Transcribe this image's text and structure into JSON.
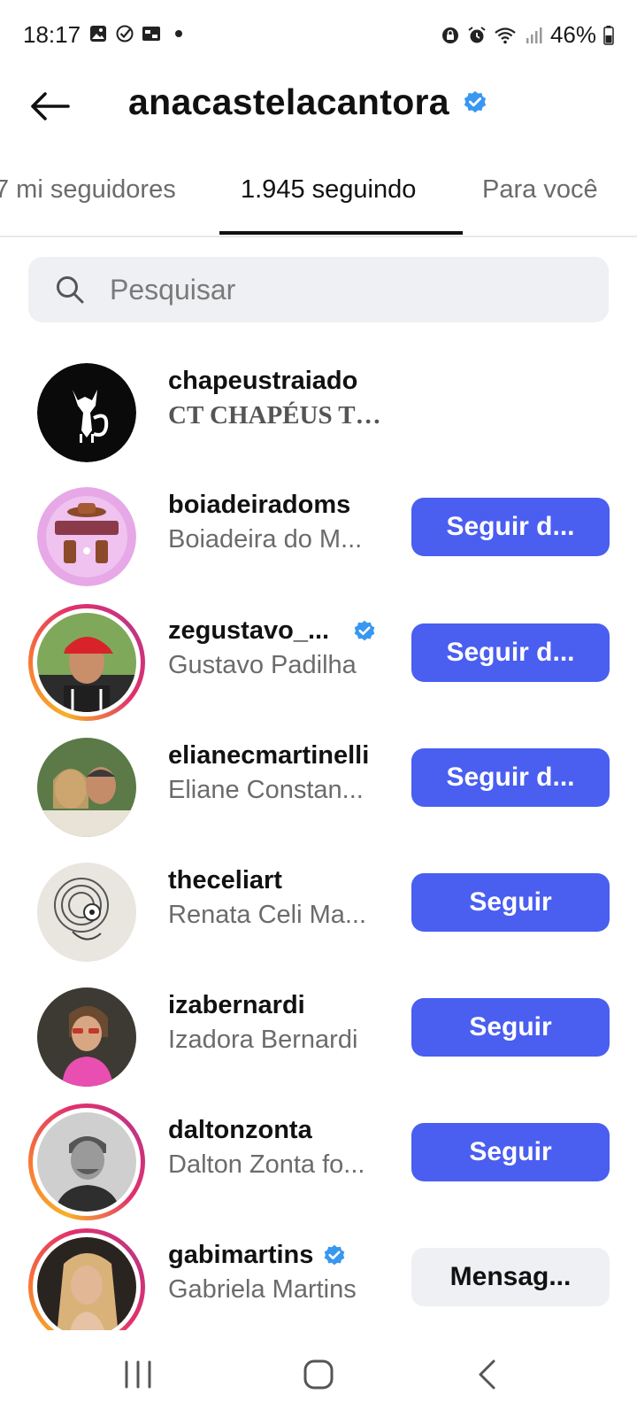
{
  "status_bar": {
    "time": "18:17",
    "battery": "46%",
    "left_icons": [
      "gallery-icon",
      "check-circle-icon",
      "key-card-icon"
    ],
    "right_icons": [
      "lock-icon",
      "alarm-icon",
      "wifi-icon",
      "signal-icon",
      "battery-icon"
    ]
  },
  "header": {
    "title": "anacastelacantora",
    "verified": true,
    "back_icon": "arrow-left-icon"
  },
  "tabs": [
    {
      "label": "7 mi seguidores",
      "active": false
    },
    {
      "label": "1.945 seguindo",
      "active": true
    },
    {
      "label": "Para você",
      "active": false
    }
  ],
  "search": {
    "placeholder": "Pesquisar"
  },
  "accounts": [
    {
      "username": "chapeustraiado",
      "name": "CT CHAPÉUS TRAIADO",
      "verified": false,
      "story": false,
      "button": "",
      "button_style": "none"
    },
    {
      "username": "boiadeiradoms",
      "name": "Boiadeira do M...",
      "verified": false,
      "story": false,
      "button": "Seguir d...",
      "button_style": "primary"
    },
    {
      "username": "zegustavo_...",
      "name": "Gustavo Padilha",
      "verified": true,
      "story": true,
      "button": "Seguir d...",
      "button_style": "primary"
    },
    {
      "username": "elianecmartinelli",
      "name": "Eliane Constan...",
      "verified": false,
      "story": false,
      "button": "Seguir d...",
      "button_style": "primary"
    },
    {
      "username": "theceliart",
      "name": "Renata Celi Ma...",
      "verified": false,
      "story": false,
      "button": "Seguir",
      "button_style": "primary"
    },
    {
      "username": "izabernardi",
      "name": "Izadora Bernardi",
      "verified": false,
      "story": false,
      "button": "Seguir",
      "button_style": "primary"
    },
    {
      "username": "daltonzonta",
      "name": "Dalton Zonta fo...",
      "verified": false,
      "story": true,
      "button": "Seguir",
      "button_style": "primary"
    },
    {
      "username": "gabimartins",
      "name": "Gabriela Martins",
      "verified": true,
      "story": true,
      "button": "Mensag...",
      "button_style": "secondary"
    }
  ],
  "colors": {
    "primary_button": "#4a5ef0",
    "verified_badge": "#3897f0",
    "secondary_button": "#eff0f3"
  },
  "navbar": {
    "icons": [
      "recent-apps-icon",
      "home-icon",
      "back-icon"
    ]
  }
}
